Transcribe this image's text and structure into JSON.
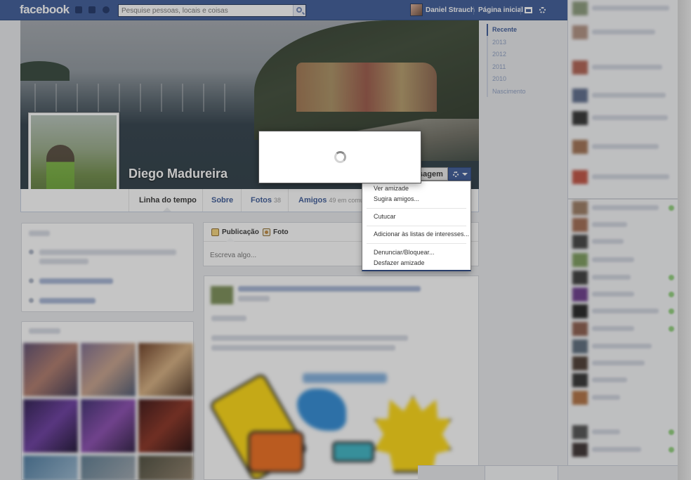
{
  "header": {
    "logo": "facebook",
    "search_placeholder": "Pesquise pessoas, locais e coisas",
    "user_name": "Daniel Strauch",
    "home_link": "Página inicial"
  },
  "profile": {
    "name": "Diego Madureira",
    "message_button_label": "sagem"
  },
  "tabs": [
    {
      "label": "Linha do tempo",
      "count": ""
    },
    {
      "label": "Sobre",
      "count": ""
    },
    {
      "label": "Fotos",
      "count": "38"
    },
    {
      "label": "Amigos",
      "count": "49 em comum"
    }
  ],
  "scrubber": {
    "items": [
      "Recente",
      "2013",
      "2012",
      "2011",
      "2010",
      "Nascimento"
    ],
    "active_index": 0
  },
  "composer": {
    "tab_status": "Publicação",
    "tab_photo": "Foto",
    "input_placeholder": "Escreva algo..."
  },
  "friend_menu": {
    "items": [
      "Ver amizade",
      "Sugira amigos...",
      "Cutucar",
      "Adicionar às listas de interesses...",
      "Denunciar/Bloquear...",
      "Desfazer amizade"
    ]
  },
  "colors": {
    "brand_blue": "#3b5998",
    "link_blue": "#3b5998",
    "online_green": "#8fcf7a"
  },
  "icons": {
    "search": "search-icon",
    "settings": "gear-icon",
    "privacy": "privacy-icon",
    "dropdown": "caret-down-icon",
    "loading": "spinner-icon"
  }
}
